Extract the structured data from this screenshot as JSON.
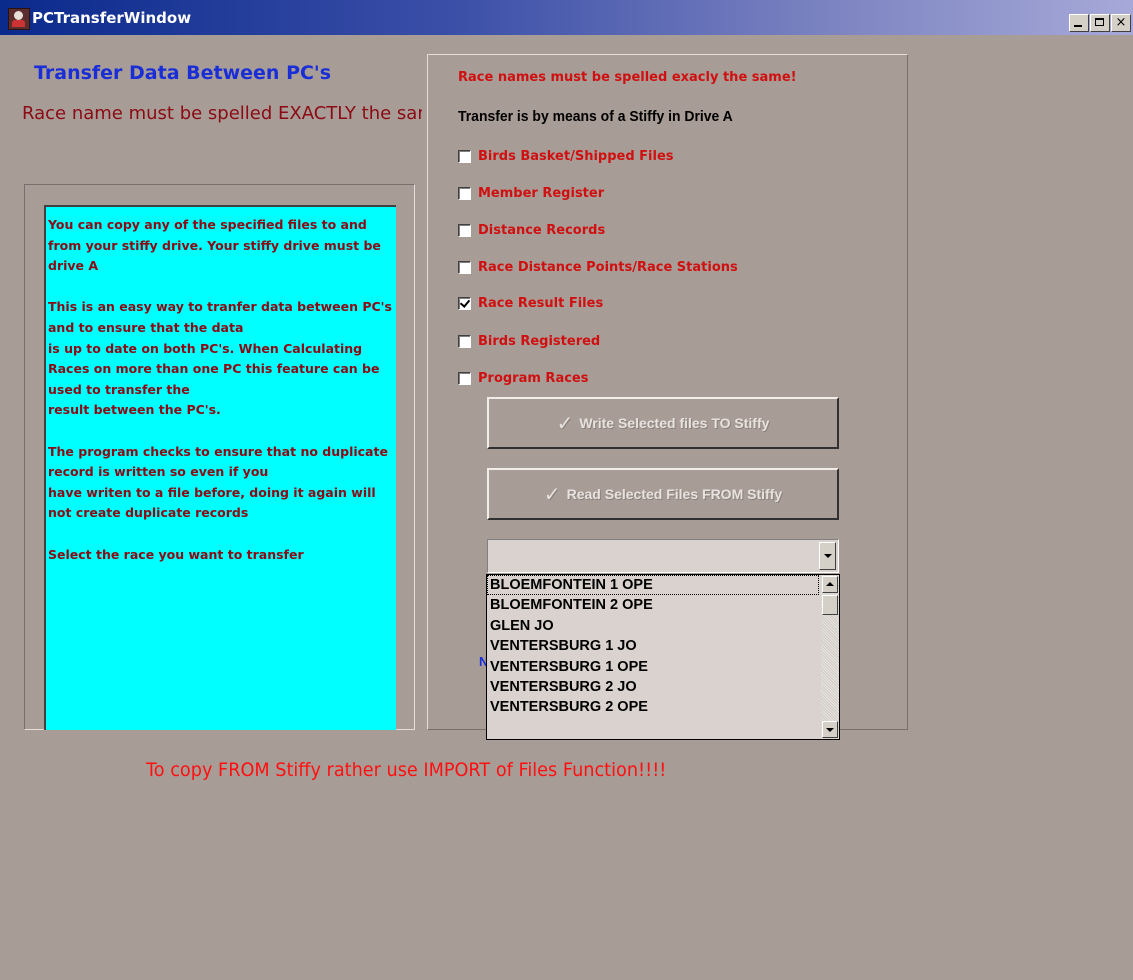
{
  "window": {
    "title": "PCTransferWindow",
    "controls": {
      "minimize": "minimize",
      "maximize": "maximize",
      "close": "×"
    }
  },
  "heading": "Transfer Data Between PC's",
  "warning": "Race name must be spelled EXACTLY the same!",
  "info_text": "You can copy any of the specified files to and from your stiffy drive. Your stiffy drive must be drive A\n\nThis is an easy way to tranfer data between PC's and to ensure that the data\nis up to date on both PC's. When Calculating Races on more than one PC this feature can be used to transfer the\nresult between the PC's.\n\nThe program checks to ensure that no duplicate record is written so even if you\nhave writen to a file before, doing it again will not create duplicate records\n\nSelect the race you want to transfer",
  "right_panel": {
    "note": "Race names must be spelled exacly the same!",
    "transfer_note": "Transfer is by means of a Stiffy in Drive A",
    "options": [
      {
        "label": "Birds Basket/Shipped Files",
        "checked": false
      },
      {
        "label": "Member Register",
        "checked": false
      },
      {
        "label": "Distance Records",
        "checked": false
      },
      {
        "label": "Race Distance Points/Race Stations",
        "checked": false
      },
      {
        "label": "Race Result Files",
        "checked": true
      },
      {
        "label": "Birds Registered",
        "checked": false
      },
      {
        "label": "Program Races",
        "checked": false
      }
    ],
    "write_button": "Write Selected files TO Stiffy",
    "read_button": "Read Selected Files FROM Stiffy",
    "check_glyph": "✓",
    "combo_value": "",
    "dropdown_items": [
      "BLOEMFONTEIN 1 OPE",
      "BLOEMFONTEIN 2 OPE",
      "GLEN JO",
      "VENTERSBURG 1 JO",
      "VENTERSBURG 1 OPE",
      "VENTERSBURG 2 JO",
      "VENTERSBURG 2 OPE"
    ],
    "partial_label": "N"
  },
  "bottom_note": "To copy FROM Stiffy rather use IMPORT of Files Function!!!!",
  "colors": {
    "background": "#a89c96",
    "heading": "#1a2ed8",
    "warning": "#8b0a14",
    "info_bg": "#00ffff",
    "option_text": "#d01010",
    "bottom_note": "#ff1010"
  }
}
